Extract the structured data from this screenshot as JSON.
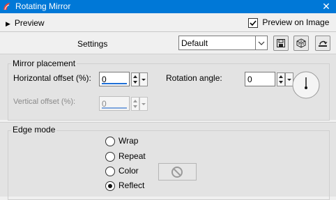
{
  "window": {
    "title": "Rotating Mirror",
    "close_glyph": "✕"
  },
  "top": {
    "preview_label": "Preview",
    "preview_on_image_label": "Preview on Image",
    "preview_on_image_checked": true
  },
  "settings": {
    "label": "Settings",
    "selected": "Default"
  },
  "mirror_placement": {
    "title": "Mirror placement",
    "horizontal_offset": {
      "label": "Horizontal offset (%):",
      "value": "0"
    },
    "vertical_offset": {
      "label": "Vertical offset (%):",
      "value": "0",
      "enabled": false
    },
    "rotation_angle": {
      "label": "Rotation angle:",
      "value": "0"
    }
  },
  "edge_mode": {
    "title": "Edge mode",
    "options": [
      {
        "label": "Wrap",
        "selected": false
      },
      {
        "label": "Repeat",
        "selected": false
      },
      {
        "label": "Color",
        "selected": false
      },
      {
        "label": "Reflect",
        "selected": true
      }
    ]
  },
  "icons": [
    "app-icon",
    "close-icon",
    "chevron-right-icon",
    "save-icon",
    "randomize-icon",
    "reset-icon",
    "no-color-icon",
    "angle-dial-icon"
  ]
}
